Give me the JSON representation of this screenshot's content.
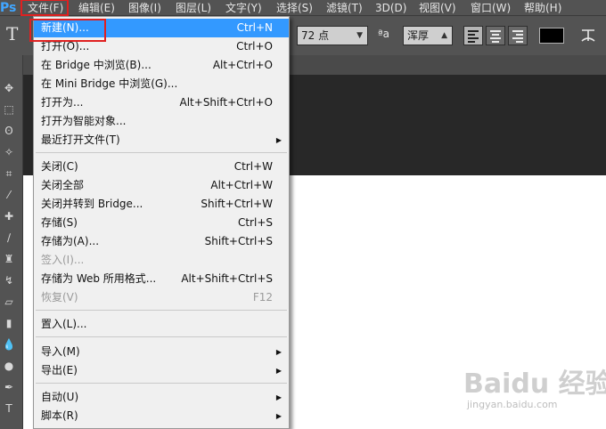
{
  "app": {
    "logo": "Ps"
  },
  "menubar": {
    "items": [
      "文件(F)",
      "编辑(E)",
      "图像(I)",
      "图层(L)",
      "文字(Y)",
      "选择(S)",
      "滤镜(T)",
      "3D(D)",
      "视图(V)",
      "窗口(W)",
      "帮助(H)"
    ]
  },
  "options_bar": {
    "tool_glyph": "T",
    "font_size": "72 点",
    "aa_icon": "ªa",
    "antialias": "浑厚",
    "text_color": "#000000"
  },
  "file_menu": {
    "items": [
      {
        "label": "新建(N)...",
        "shortcut": "Ctrl+N",
        "state": "highlighted"
      },
      {
        "label": "打开(O)...",
        "shortcut": "Ctrl+O",
        "state": "normal"
      },
      {
        "label": "在 Bridge 中浏览(B)...",
        "shortcut": "Alt+Ctrl+O",
        "state": "normal"
      },
      {
        "label": "在 Mini Bridge 中浏览(G)...",
        "shortcut": "",
        "state": "normal"
      },
      {
        "label": "打开为...",
        "shortcut": "Alt+Shift+Ctrl+O",
        "state": "normal"
      },
      {
        "label": "打开为智能对象...",
        "shortcut": "",
        "state": "normal"
      },
      {
        "label": "最近打开文件(T)",
        "shortcut": "",
        "state": "submenu"
      },
      {
        "label": "关闭(C)",
        "shortcut": "Ctrl+W",
        "state": "normal"
      },
      {
        "label": "关闭全部",
        "shortcut": "Alt+Ctrl+W",
        "state": "normal"
      },
      {
        "label": "关闭并转到 Bridge...",
        "shortcut": "Shift+Ctrl+W",
        "state": "normal"
      },
      {
        "label": "存储(S)",
        "shortcut": "Ctrl+S",
        "state": "normal"
      },
      {
        "label": "存储为(A)...",
        "shortcut": "Shift+Ctrl+S",
        "state": "normal"
      },
      {
        "label": "签入(I)...",
        "shortcut": "",
        "state": "disabled"
      },
      {
        "label": "存储为 Web 所用格式...",
        "shortcut": "Alt+Shift+Ctrl+S",
        "state": "normal"
      },
      {
        "label": "恢复(V)",
        "shortcut": "F12",
        "state": "disabled"
      },
      {
        "label": "置入(L)...",
        "shortcut": "",
        "state": "normal"
      },
      {
        "label": "导入(M)",
        "shortcut": "",
        "state": "submenu"
      },
      {
        "label": "导出(E)",
        "shortcut": "",
        "state": "submenu"
      },
      {
        "label": "自动(U)",
        "shortcut": "",
        "state": "submenu"
      },
      {
        "label": "脚本(R)",
        "shortcut": "",
        "state": "submenu"
      }
    ],
    "submenu_arrow": "▶"
  },
  "watermark": {
    "logo": "Baidu 经验",
    "sub": "jingyan.baidu.com"
  },
  "colors": {
    "highlight": "#3399ff",
    "annotation_red": "#e02020"
  }
}
